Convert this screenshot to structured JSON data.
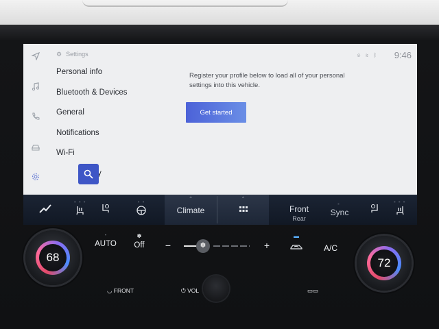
{
  "screen": {
    "settings_header": "Settings",
    "time": "9:46",
    "menu_items": [
      {
        "label": "Personal info"
      },
      {
        "label": "Bluetooth & Devices"
      },
      {
        "label": "General"
      },
      {
        "label": "Notifications"
      },
      {
        "label": "Wi-Fi"
      },
      {
        "label": "y"
      }
    ],
    "intro_text": "Register your profile below to load all of your personal settings into this vehicle.",
    "get_started_label": "Get started",
    "status_icons": [
      "wifi-icon",
      "signal-icon",
      "bluetooth-icon"
    ]
  },
  "rail_icons": [
    "navigation-icon",
    "music-icon",
    "phone-icon",
    "car-icon",
    "settings-gear-icon"
  ],
  "climate_bar": {
    "climate_label": "Climate",
    "front_label": "Front",
    "rear_label": "Rear",
    "sync_label": "Sync"
  },
  "controls": {
    "auto_label": "AUTO",
    "off_label": "Off",
    "minus_label": "−",
    "plus_label": "+",
    "ac_label": "A/C",
    "left_temp": "68",
    "right_temp": "72",
    "front_defrost_label": "FRONT",
    "vol_label": "VOL",
    "fan_level": 0.3
  },
  "colors": {
    "accent": "#3e56c6",
    "button_start": "#4c62d8",
    "button_end": "#6a8ee6",
    "screen_bg": "#eeeff1",
    "climate_bar_bg": "#1b2434"
  }
}
